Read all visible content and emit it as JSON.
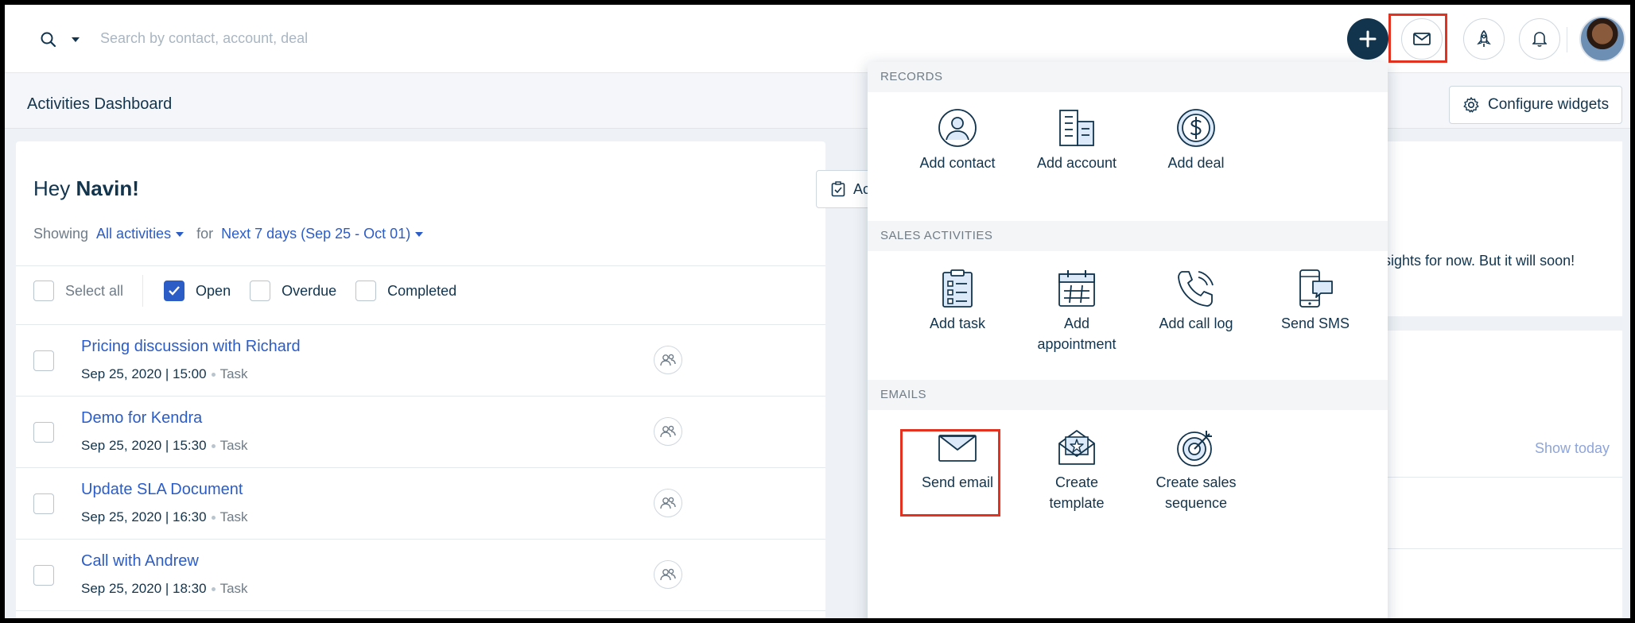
{
  "topbar": {
    "search_placeholder": "Search by contact, account, deal"
  },
  "header": {
    "title": "Activities Dashboard",
    "configure_label": "Configure widgets"
  },
  "greeting": {
    "prefix": "Hey",
    "name": "Navin!"
  },
  "activities_button_label": "Ac",
  "filters": {
    "showing": "Showing",
    "scope": "All activities",
    "for": "for",
    "range": "Next 7 days (Sep 25 - Oct 01)"
  },
  "status_filters": {
    "select_all": "Select all",
    "open": "Open",
    "overdue": "Overdue",
    "completed": "Completed"
  },
  "activities": [
    {
      "title": "Pricing discussion with Richard",
      "datetime": "Sep 25, 2020 | 15:00",
      "type": "Task"
    },
    {
      "title": "Demo for Kendra",
      "datetime": "Sep 25, 2020 | 15:30",
      "type": "Task"
    },
    {
      "title": "Update SLA Document",
      "datetime": "Sep 25, 2020 | 16:30",
      "type": "Task"
    },
    {
      "title": "Call with Andrew",
      "datetime": "Sep 25, 2020 | 18:30",
      "type": "Task"
    }
  ],
  "insights_text": "sights for now. But it will soon!",
  "show_today": "Show today",
  "quick_menu": {
    "records": {
      "heading": "RECORDS",
      "items": [
        "Add contact",
        "Add account",
        "Add deal"
      ]
    },
    "sales_activities": {
      "heading": "SALES ACTIVITIES",
      "items": [
        {
          "line1": "Add task",
          "line2": ""
        },
        {
          "line1": "Add",
          "line2": "appointment"
        },
        {
          "line1": "Add call log",
          "line2": ""
        },
        {
          "line1": "Send SMS",
          "line2": ""
        }
      ]
    },
    "emails": {
      "heading": "EMAILS",
      "items": [
        {
          "line1": "Send email",
          "line2": ""
        },
        {
          "line1": "Create",
          "line2": "template"
        },
        {
          "line1": "Create sales",
          "line2": "sequence"
        }
      ]
    }
  },
  "colors": {
    "accent": "#2c5cc5",
    "dark": "#12344d",
    "highlight": "#e3321f"
  }
}
